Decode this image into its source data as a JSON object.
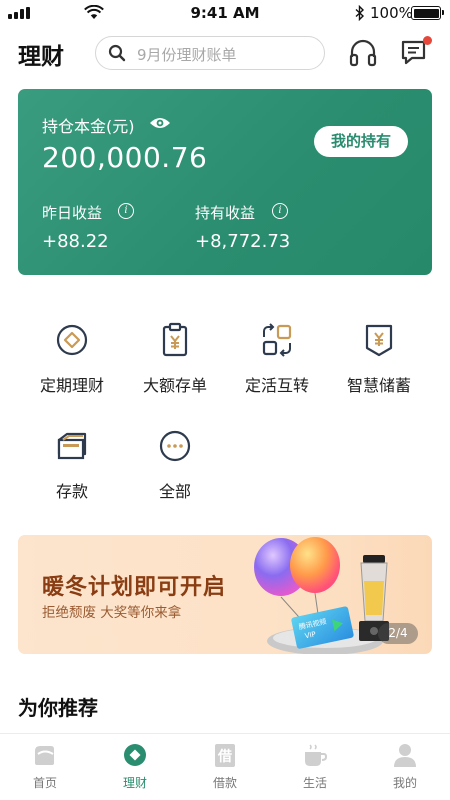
{
  "status_bar": {
    "time": "9:41 AM",
    "battery": "100%"
  },
  "header": {
    "title": "理财",
    "search_placeholder": "9月份理财账单",
    "has_unread_message": true
  },
  "asset_card": {
    "principal_label": "持仓本金(元)",
    "principal_value": "200,000.76",
    "holdings_button": "我的持有",
    "yesterday_label": "昨日收益",
    "yesterday_value": "+88.22",
    "holding_label": "持有收益",
    "holding_value": "+8,772.73",
    "info_glyph": "i"
  },
  "services": [
    {
      "label": "定期理财",
      "icon": "coin-circle-icon"
    },
    {
      "label": "大额存单",
      "icon": "yen-clipboard-icon"
    },
    {
      "label": "定活互转",
      "icon": "swap-squares-icon"
    },
    {
      "label": "智慧储蓄",
      "icon": "yen-shield-icon"
    },
    {
      "label": "存款",
      "icon": "passbook-icon"
    },
    {
      "label": "全部",
      "icon": "more-dots-icon"
    }
  ],
  "banner": {
    "title": "暖冬计划即可开启",
    "subtitle": "拒绝颓废   大奖等你来拿",
    "page_indicator": "2/4",
    "card_text": "腾讯视频\nVIP"
  },
  "recommend": {
    "title": "为你推荐"
  },
  "tab_bar": {
    "active_index": 1,
    "tabs": [
      {
        "label": "首页",
        "icon": "home-icon"
      },
      {
        "label": "理财",
        "icon": "wealth-icon"
      },
      {
        "label": "借款",
        "icon": "loan-icon"
      },
      {
        "label": "生活",
        "icon": "cup-icon"
      },
      {
        "label": "我的",
        "icon": "profile-icon"
      }
    ]
  },
  "colors": {
    "brand_green": "#2b8d6f",
    "banner_title": "#8a3d12",
    "notification_red": "#e5483a"
  }
}
